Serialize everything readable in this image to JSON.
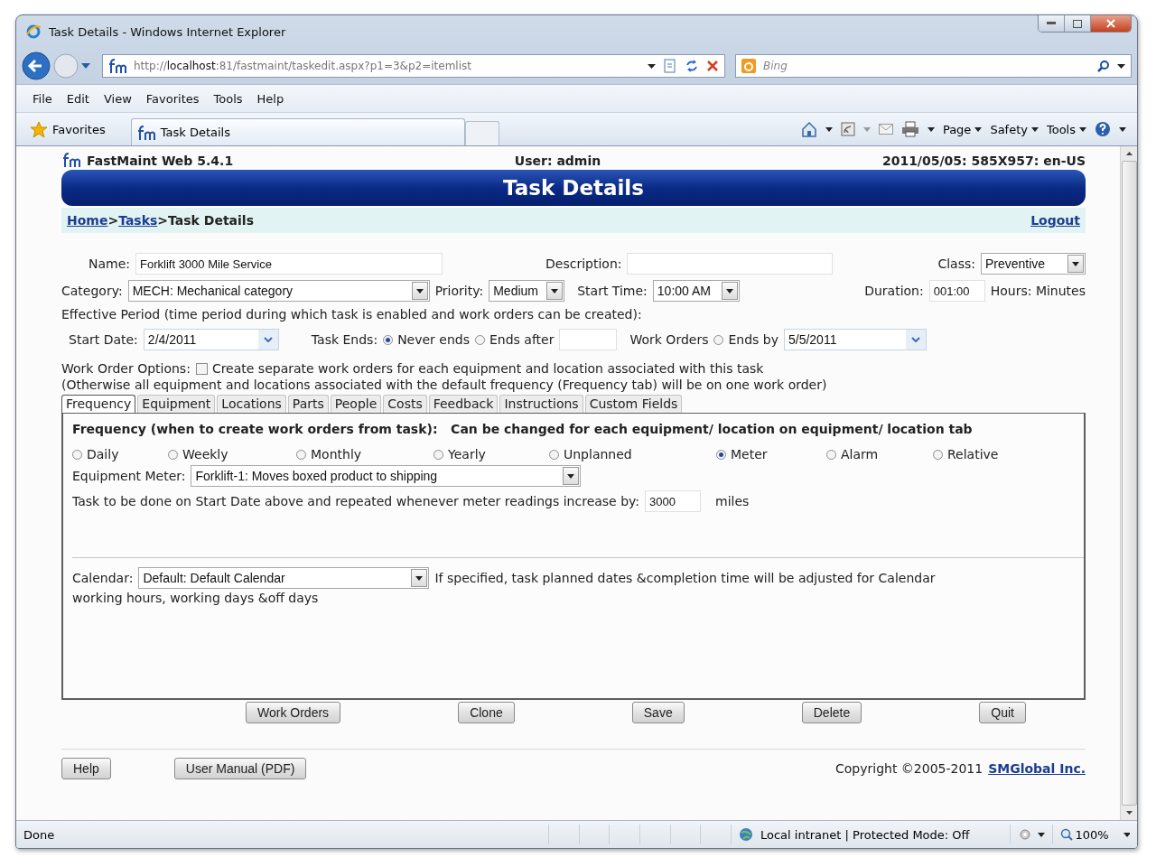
{
  "window": {
    "title": "Task Details - Windows Internet Explorer"
  },
  "address_bar": {
    "url": "http://**localhost**:81/fastmaint/taskedit.aspx?p1=3&p2=itemlist"
  },
  "search": {
    "placeholder": "Bing"
  },
  "menu": [
    "File",
    "Edit",
    "View",
    "Favorites",
    "Tools",
    "Help"
  ],
  "favorites": {
    "label": "Favorites",
    "tab": "Task Details",
    "commands": [
      "Page",
      "Safety",
      "Tools"
    ]
  },
  "header": {
    "product": "FastMaint Web 5.4.1",
    "user": "User: admin",
    "info": "2011/05/05: 585X957: en-US",
    "banner": "Task Details"
  },
  "breadcrumb": [
    {
      "label": "Home",
      "kind": "link"
    },
    {
      "label": ">",
      "kind": "text"
    },
    {
      "label": "Tasks",
      "kind": "link"
    },
    {
      "label": ">",
      "kind": "text"
    },
    {
      "label": "Task Details",
      "kind": "text"
    }
  ],
  "logout": "Logout",
  "form": {
    "name": {
      "label": "Name:",
      "value": "Forklift 3000 Mile Service"
    },
    "description": {
      "label": "Description:"
    },
    "class": {
      "label": "Class:",
      "value": "Preventive"
    },
    "category": {
      "label": "Category:",
      "value": "MECH: Mechanical category"
    },
    "priority": {
      "label": "Priority:",
      "value": "Medium"
    },
    "start_time": {
      "label": "Start Time:",
      "value": "10:00 AM"
    },
    "duration": {
      "label": "Duration:",
      "value": "001:00",
      "unit": "Hours: Minutes"
    },
    "effective_period": "Effective Period (time period during which task is enabled and work orders can be created):",
    "start_date": {
      "label": "Start Date:",
      "value": "2/4/2011"
    },
    "task_ends": {
      "label": "Task Ends:",
      "options": [
        {
          "kind": "never",
          "label": "Never ends",
          "selected": true
        },
        {
          "kind": "after",
          "label": "Ends after",
          "suffix": "Work Orders",
          "selected": false
        },
        {
          "kind": "by",
          "label": "Ends by",
          "value": "5/5/2011",
          "selected": false
        }
      ]
    },
    "work_order_options": {
      "label": "Work Order Options:",
      "checkbox": {
        "label": "Create separate work orders for each equipment and location associated with this task",
        "checked": false
      },
      "note": "(Otherwise all equipment and locations associated with the default frequency (Frequency tab) will be on one work order)"
    }
  },
  "tabs": [
    {
      "label": "Frequency",
      "selected": true
    },
    {
      "label": "Equipment",
      "selected": false
    },
    {
      "label": "Locations",
      "selected": false
    },
    {
      "label": "Parts",
      "selected": false
    },
    {
      "label": "People",
      "selected": false
    },
    {
      "label": "Costs",
      "selected": false
    },
    {
      "label": "Feedback",
      "selected": false
    },
    {
      "label": "Instructions",
      "selected": false
    },
    {
      "label": "Custom Fields",
      "selected": false
    }
  ],
  "frequency": {
    "heading": "Frequency (when to create work orders from task):   Can be changed for each equipment/ location on equipment/ location tab",
    "options": [
      {
        "label": "Daily",
        "selected": false
      },
      {
        "label": "Weekly",
        "selected": false
      },
      {
        "label": "Monthly",
        "selected": false
      },
      {
        "label": "Yearly",
        "selected": false
      },
      {
        "label": "Unplanned",
        "selected": false
      },
      {
        "label": "Meter",
        "selected": true
      },
      {
        "label": "Alarm",
        "selected": false
      },
      {
        "label": "Relative",
        "selected": false
      }
    ],
    "meter": {
      "label": "Equipment Meter:",
      "value": "Forklift-1: Moves boxed product to shipping"
    },
    "repeat": {
      "label": "Task to be done on Start Date above and repeated whenever meter readings increase by:",
      "value": "3000",
      "unit": "miles"
    },
    "calendar": {
      "label": "Calendar:",
      "value": "Default: Default Calendar",
      "note_lines": [
        "If specified, task planned dates &completion time will be adjusted for Calendar",
        "working hours, working days &off days"
      ]
    }
  },
  "buttons": [
    "Work Orders",
    "Clone",
    "Save",
    "Delete",
    "Quit"
  ],
  "footer": {
    "buttons": [
      "Help",
      "User Manual (PDF)"
    ],
    "copyright": "Copyright ©2005-2011",
    "company": "SMGlobal Inc."
  },
  "status_bar": {
    "text": "Done",
    "zone": "Local intranet | Protected Mode: Off",
    "zoom": "100%"
  }
}
